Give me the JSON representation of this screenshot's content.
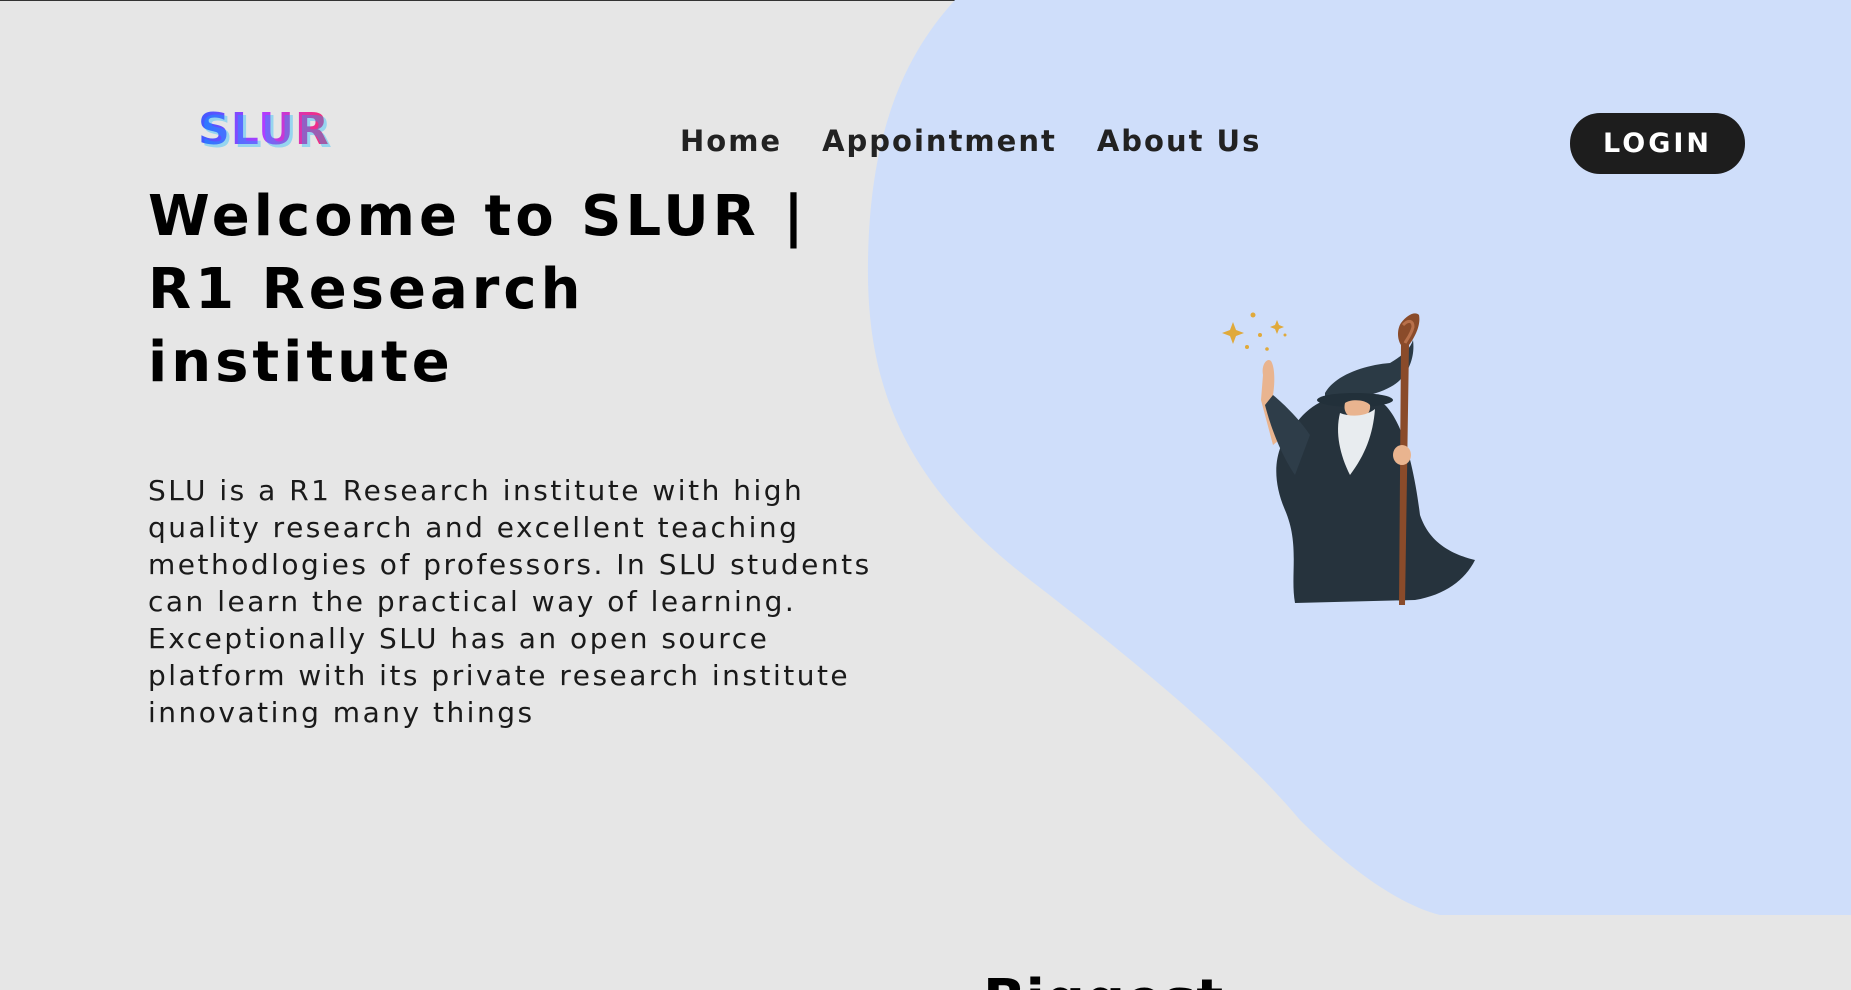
{
  "brand": {
    "logo_text": "SLUR"
  },
  "nav": {
    "items": [
      {
        "label": "Home"
      },
      {
        "label": "Appointment"
      },
      {
        "label": "About Us"
      }
    ],
    "login_label": "LOGIN"
  },
  "hero": {
    "title": "Welcome to SLUR | R1 Research institute",
    "description": "SLU is a R1 Research institute with high quality research and excellent teaching methodlogies of professors. In SLU students can learn the practical way of learning. Exceptionally SLU has an open source platform with its private research institute innovating many things",
    "illustration": "wizard-illustration"
  },
  "next_section": {
    "heading_partial": "Biggest"
  },
  "colors": {
    "background": "#e6e6e6",
    "blob": "#cfdefa",
    "login_bg": "#1d1d1d",
    "text": "#000000"
  }
}
